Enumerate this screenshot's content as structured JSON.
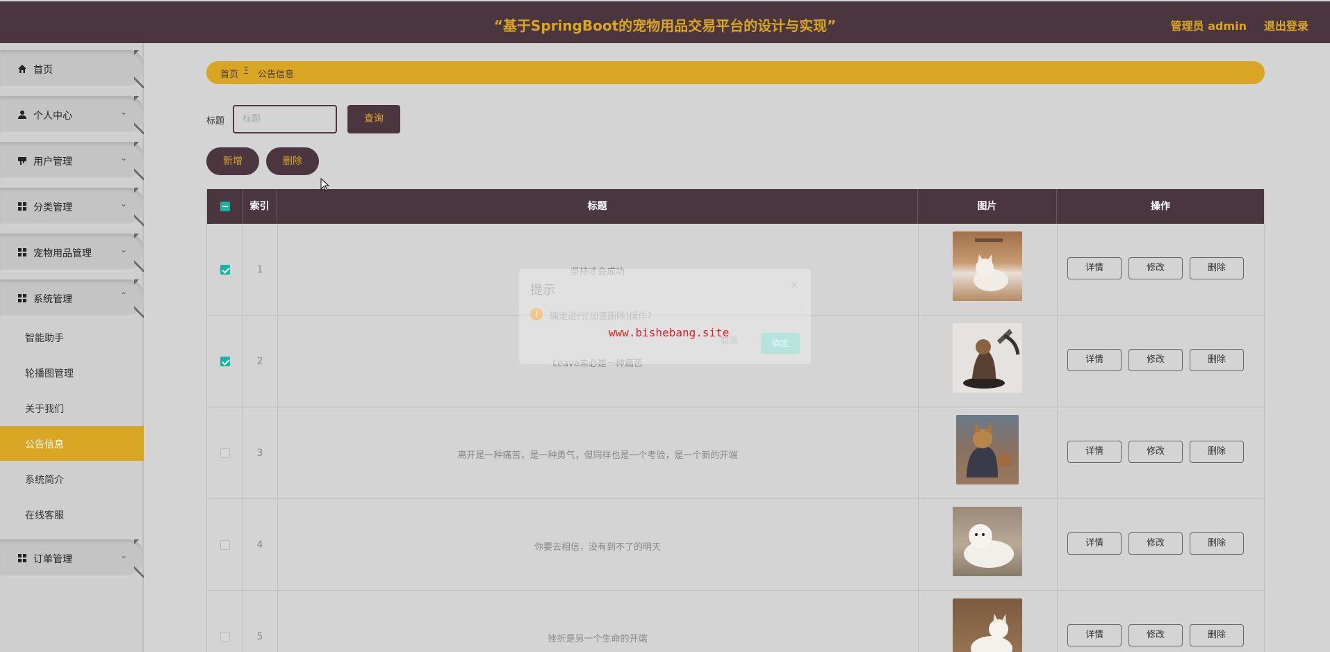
{
  "header": {
    "title": "“基于SpringBoot的宠物用品交易平台的设计与实现”",
    "user_label": "管理员 admin",
    "logout_label": "退出登录"
  },
  "sidebar": {
    "groups": [
      {
        "label": "首页",
        "icon": "home-icon"
      },
      {
        "label": "个人中心",
        "icon": "person-icon"
      },
      {
        "label": "用户管理",
        "icon": "user-manage-icon"
      },
      {
        "label": "分类管理",
        "icon": "grid-icon"
      },
      {
        "label": "宠物用品管理",
        "icon": "grid-icon"
      },
      {
        "label": "系统管理",
        "icon": "grid-icon"
      },
      {
        "label": "订单管理",
        "icon": "grid-icon"
      }
    ],
    "sub_items": [
      {
        "label": "智能助手"
      },
      {
        "label": "轮播图管理"
      },
      {
        "label": "关于我们"
      },
      {
        "label": "公告信息"
      },
      {
        "label": "系统简介"
      },
      {
        "label": "在线客服"
      }
    ]
  },
  "breadcrumb": {
    "home": "首页",
    "separator": "Ξ",
    "current": "公告信息"
  },
  "search": {
    "label": "标题",
    "placeholder": "标题",
    "button": "查询"
  },
  "actions": {
    "add": "新增",
    "delete": "删除"
  },
  "table": {
    "columns": [
      "索引",
      "标题",
      "图片",
      "操作"
    ],
    "row_buttons": {
      "detail": "详情",
      "edit": "修改",
      "delete": "删除"
    },
    "rows": [
      {
        "index": "1",
        "title": "坚持才会成功",
        "checked": true
      },
      {
        "index": "2",
        "title": "Leave未必是一种痛苦",
        "checked": true
      },
      {
        "index": "3",
        "title": "离开是一种痛苦，是一种勇气，但同样也是一个考验，是一个新的开端",
        "checked": false
      },
      {
        "index": "4",
        "title": "你要去相信，没有到不了的明天",
        "checked": false
      },
      {
        "index": "5",
        "title": "挫折是另一个生命的开端",
        "checked": false
      }
    ]
  },
  "dialog": {
    "title": "提示",
    "message": "确定进行[加速删除]操作?",
    "cancel": "取消",
    "confirm": "确定"
  },
  "watermark": "www.bishebang.site",
  "colors": {
    "header_bg": "#4b3640",
    "accent": "#d9a623",
    "check": "#17b3a3"
  }
}
